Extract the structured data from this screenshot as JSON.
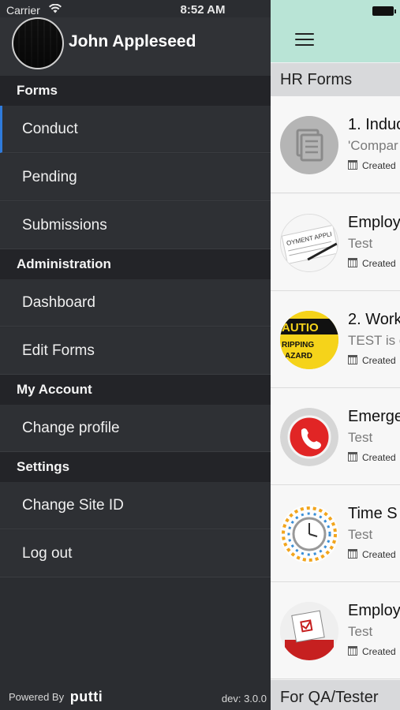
{
  "status_bar": {
    "carrier": "Carrier",
    "time": "8:52 AM"
  },
  "profile": {
    "name": "John Appleseed"
  },
  "drawer": {
    "sections": [
      {
        "title": "Forms",
        "items": [
          {
            "label": "Conduct",
            "active": true
          },
          {
            "label": "Pending"
          },
          {
            "label": "Submissions"
          }
        ]
      },
      {
        "title": "Administration",
        "items": [
          {
            "label": "Dashboard"
          },
          {
            "label": "Edit Forms"
          }
        ]
      },
      {
        "title": "My Account",
        "items": [
          {
            "label": "Change profile"
          }
        ]
      },
      {
        "title": "Settings",
        "items": [
          {
            "label": "Change Site ID"
          },
          {
            "label": "Log out"
          }
        ]
      }
    ],
    "footer": {
      "powered_by": "Powered By",
      "brand": "putti",
      "version": "dev: 3.0.0"
    }
  },
  "main": {
    "groups": [
      {
        "title": "HR Forms",
        "forms": [
          {
            "title": "1. Induc",
            "subtitle": "'Compar",
            "meta": "Created",
            "icon": "document-icon"
          },
          {
            "title": "Employ",
            "subtitle": "Test",
            "meta": "Created",
            "icon": "employment-application-icon"
          },
          {
            "title": "2. Work",
            "subtitle": "TEST is c",
            "meta": "Created",
            "icon": "caution-sign-icon"
          },
          {
            "title": "Emerge",
            "subtitle": "Test",
            "meta": "Created",
            "icon": "emergency-phone-icon"
          },
          {
            "title": "Time S",
            "subtitle": "Test",
            "meta": "Created",
            "icon": "clock-icon"
          },
          {
            "title": "Employ",
            "subtitle": "Test",
            "meta": "Created",
            "icon": "complaint-box-icon"
          }
        ]
      },
      {
        "title": "For QA/Tester",
        "forms": []
      }
    ]
  },
  "colors": {
    "drawer_bg": "#2b2d31",
    "section_header_bg": "#232428",
    "active_accent": "#2f7bdc",
    "topbar_bg": "#b9e4d6"
  }
}
